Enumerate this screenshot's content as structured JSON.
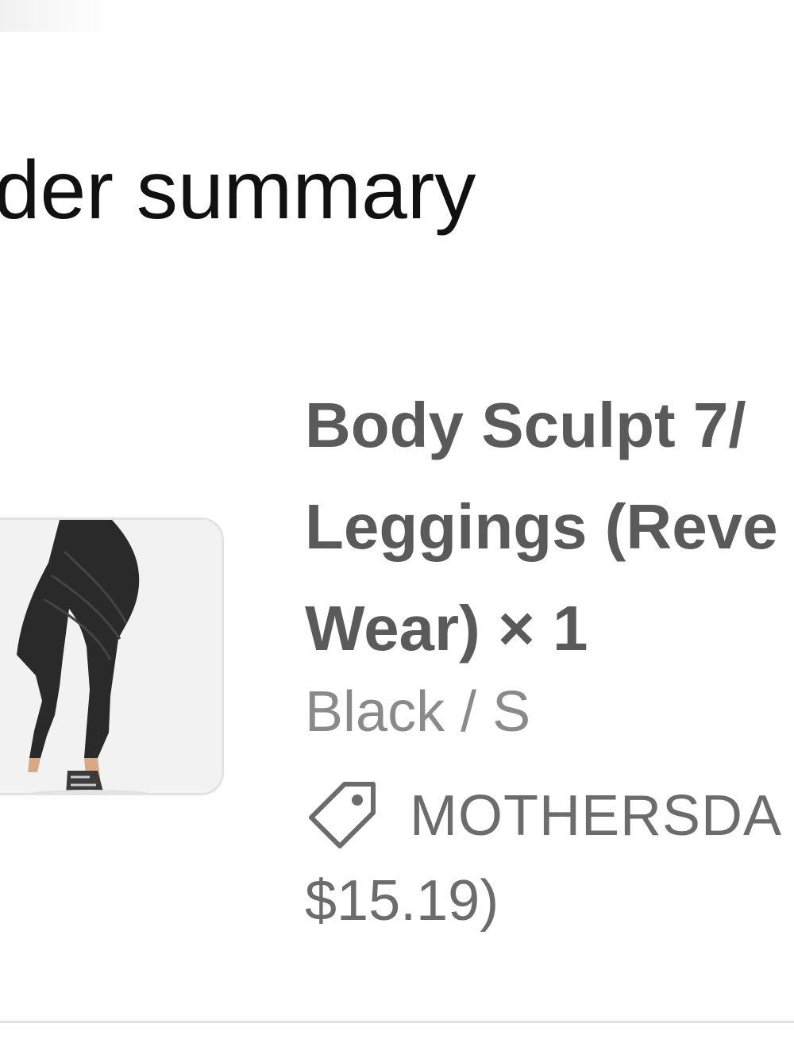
{
  "order_summary": {
    "heading": "rder summary"
  },
  "line_item": {
    "title_line1": "Body Sculpt 7/",
    "title_line2": "Leggings (Reve",
    "title_line3": "Wear) × 1",
    "variant": "Black / S",
    "discount_code": "MOTHERSDA",
    "discount_amount": "$15.19)",
    "image_icon": "leggings-product-image",
    "tag_icon": "tag-icon"
  },
  "colors": {
    "title": "#5a5a5a",
    "muted": "#8a8a8a",
    "heading": "#111111",
    "border": "#e3e3e3"
  }
}
